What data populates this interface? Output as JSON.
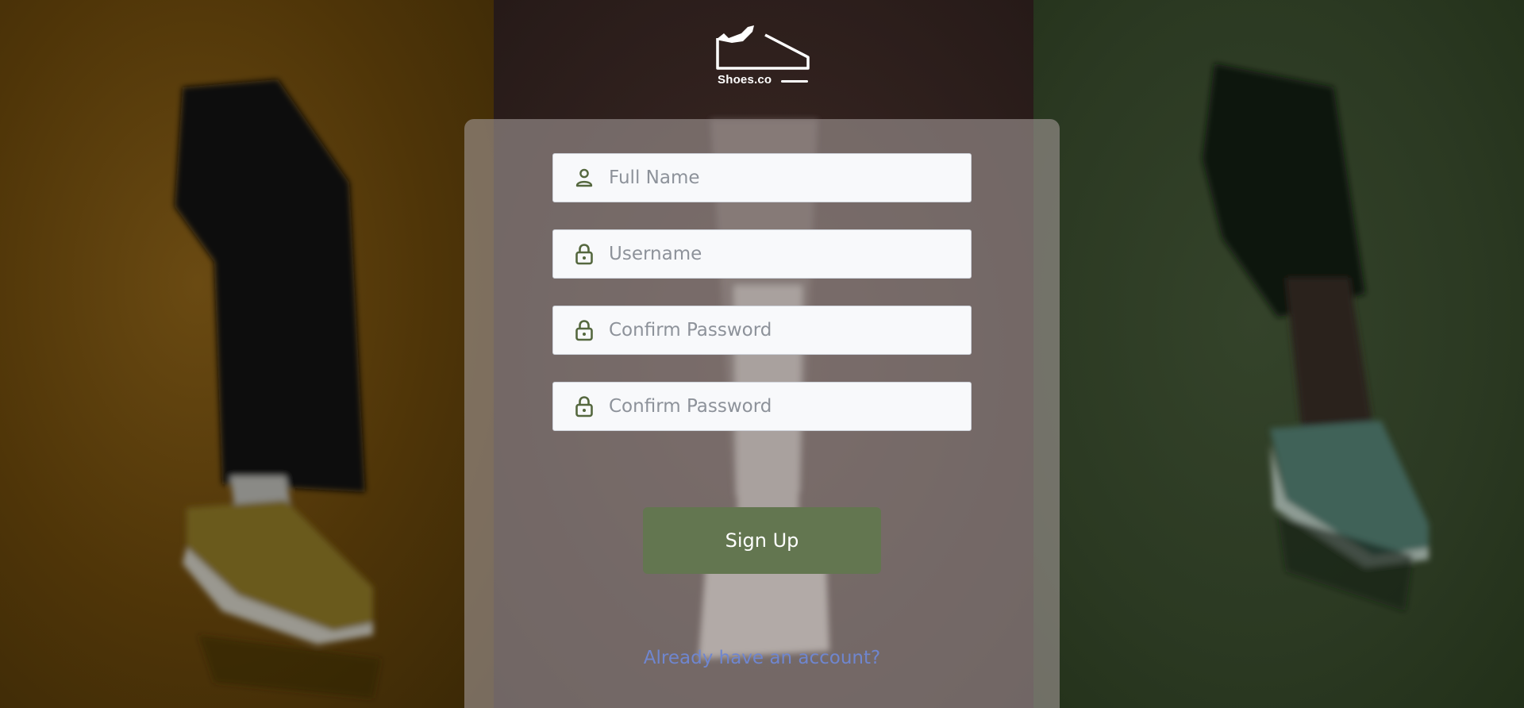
{
  "brand": {
    "name": "Shoes.co",
    "logo_icon": "sneaker-icon"
  },
  "form": {
    "fields": [
      {
        "name": "full-name",
        "placeholder": "Full Name",
        "value": "",
        "icon": "user-icon"
      },
      {
        "name": "username",
        "placeholder": "Username",
        "value": "",
        "icon": "lock-icon"
      },
      {
        "name": "password",
        "placeholder": "Confirm Password",
        "value": "",
        "icon": "lock-icon"
      },
      {
        "name": "confirm-password",
        "placeholder": "Confirm Password",
        "value": "",
        "icon": "lock-icon"
      }
    ],
    "submit_label": "Sign Up",
    "login_link": "Already have an account?"
  },
  "colors": {
    "accent": "#637650",
    "icon": "#55683f",
    "link": "#6f86cf",
    "field_bg": "#f8f9fb"
  }
}
